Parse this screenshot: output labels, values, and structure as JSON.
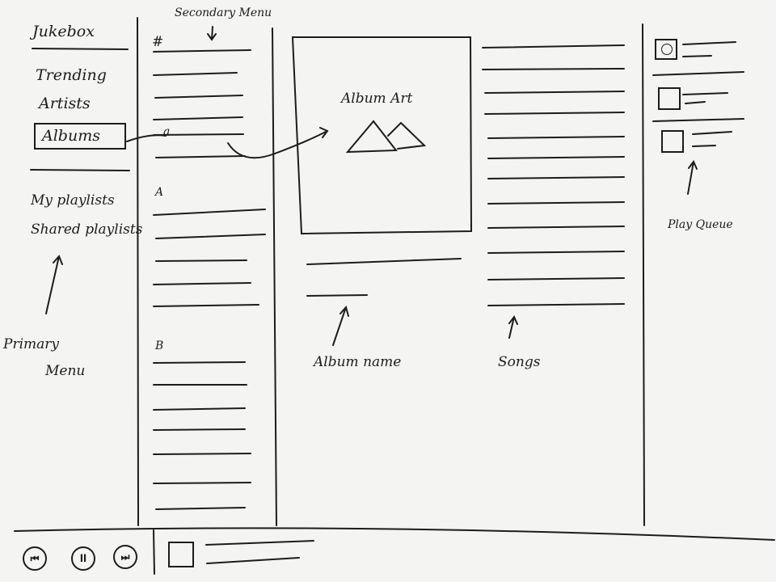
{
  "primary_menu": {
    "app_name": "Jukebox",
    "items": [
      "Trending",
      "Artists",
      "Albums"
    ],
    "playlists": [
      "My playlists",
      "Shared playlists"
    ],
    "annotation": [
      "Primary",
      "Menu"
    ]
  },
  "secondary_menu": {
    "annotation": "Secondary Menu",
    "section_headers": [
      "#",
      "a",
      "A",
      "B"
    ]
  },
  "album_detail": {
    "art_label": "Album Art",
    "name_annotation": "Album name"
  },
  "songs": {
    "annotation": "Songs"
  },
  "play_queue": {
    "annotation": "Play Queue"
  },
  "player": {
    "controls": {
      "previous": "prev-icon",
      "pause": "pause-icon",
      "next": "next-icon"
    }
  }
}
